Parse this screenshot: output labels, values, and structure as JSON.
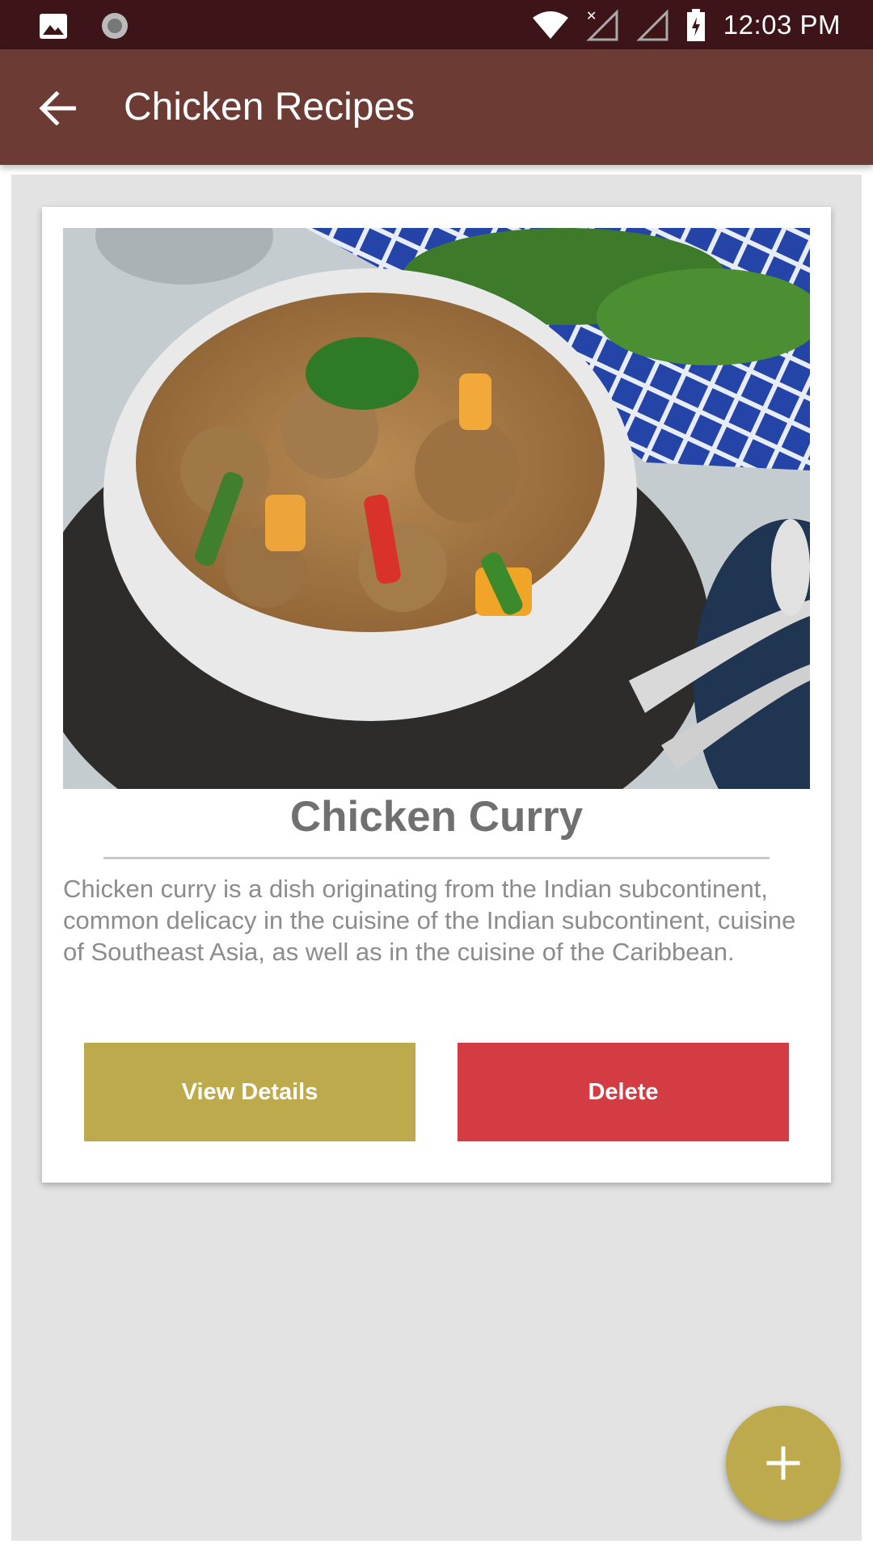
{
  "status_bar": {
    "time": "12:03 PM",
    "icons": [
      "image-icon",
      "sync-icon",
      "wifi-icon",
      "signal-no-service-icon",
      "signal-icon",
      "battery-charging-icon"
    ]
  },
  "app_bar": {
    "title": "Chicken Recipes",
    "back_icon": "arrow-back-icon"
  },
  "recipes": [
    {
      "title": "Chicken Curry",
      "description": "Chicken curry is a dish originating from the Indian subcontinent, common delicacy in the cuisine of the Indian subcontinent, cuisine of Southeast Asia, as well as in the cuisine of the Caribbean.",
      "view_label": "View Details",
      "delete_label": "Delete"
    }
  ],
  "fab": {
    "icon": "plus-icon"
  },
  "colors": {
    "status_bar": "#3d1417",
    "app_bar": "#6b3b34",
    "accent": "#bdaa4d",
    "danger": "#d43c44",
    "background": "#e3e3e3"
  }
}
